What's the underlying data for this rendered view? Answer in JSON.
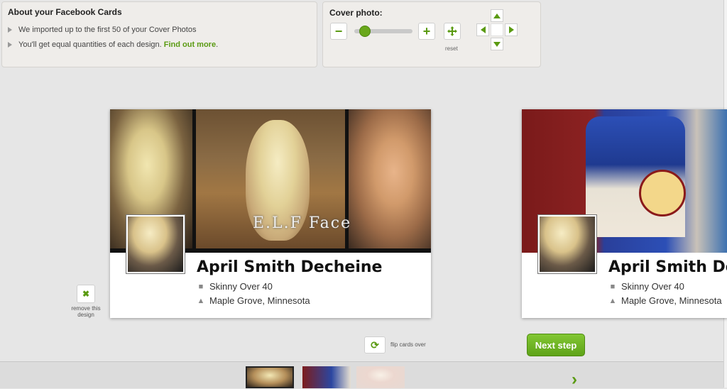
{
  "info": {
    "title": "About your Facebook Cards",
    "line1": "We imported up to the first 50 of your Cover Photos",
    "line2_prefix": "You'll get equal quantities of each design.",
    "line2_link": "Find out more",
    "line2_suffix": "."
  },
  "cover_controls": {
    "label": "Cover photo:",
    "zoom_out": "−",
    "zoom_in": "+",
    "zoom_level": 0.1,
    "reset_label": "reset"
  },
  "cards": [
    {
      "cover_caption": "E.L.F Face",
      "name": "April Smith Decheine",
      "work": "Skinny Over 40",
      "location": "Maple Grove, Minnesota"
    },
    {
      "name": "April Smith Decheine",
      "work": "Skinny Over 40",
      "location": "Maple Grove, Minnesota"
    }
  ],
  "actions": {
    "remove_label": "remove this design",
    "flip_label": "flip cards over",
    "next_step": "Next step"
  },
  "colors": {
    "accent_green": "#5a9a12",
    "button_green": "#6fb526"
  },
  "icons": {
    "remove": "x-icon",
    "flip": "rotate-icon",
    "reset": "move-arrows-icon",
    "work": "briefcase-icon",
    "location": "home-icon"
  }
}
